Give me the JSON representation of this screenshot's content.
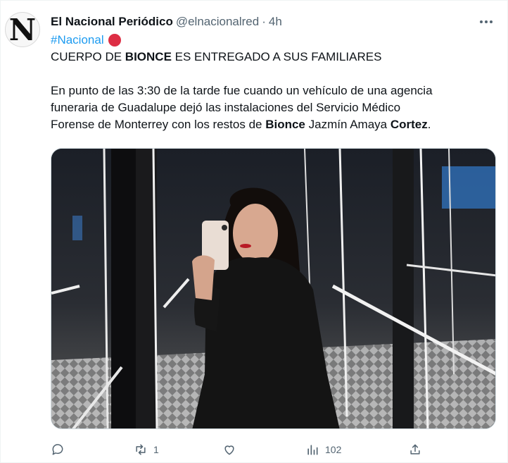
{
  "tweet": {
    "avatar_letter": "N",
    "display_name": "El Nacional Periódico",
    "handle": "@elnacionalred",
    "separator": "·",
    "time": "4h",
    "hashtag": "#Nacional",
    "headline": {
      "part1": "CUERPO DE ",
      "bold": "BIONCE",
      "part2": " ES ENTREGADO A SUS FAMILIARES"
    },
    "paragraph": {
      "line1": "En punto de las 3:30 de la tarde fue cuando un vehículo de una agencia",
      "line2": "funeraria de Guadalupe dejó las instalaciones del Servicio Médico",
      "line3_part1": "Forense de Monterrey con los restos de ",
      "line3_bold1": "Bionce",
      "line3_part2": " Jazmín Amaya ",
      "line3_bold2": "Cortez",
      "line3_end": "."
    },
    "actions": {
      "reply_count": "",
      "retweet_count": "1",
      "like_count": "",
      "views_count": "102"
    }
  },
  "colors": {
    "accent": "#1d9bf0",
    "secondary_text": "#536471",
    "primary_text": "#0f1419",
    "red_circle": "#dd2e44"
  },
  "icons": [
    "more-icon",
    "reply-icon",
    "retweet-icon",
    "like-icon",
    "views-icon",
    "share-icon"
  ]
}
